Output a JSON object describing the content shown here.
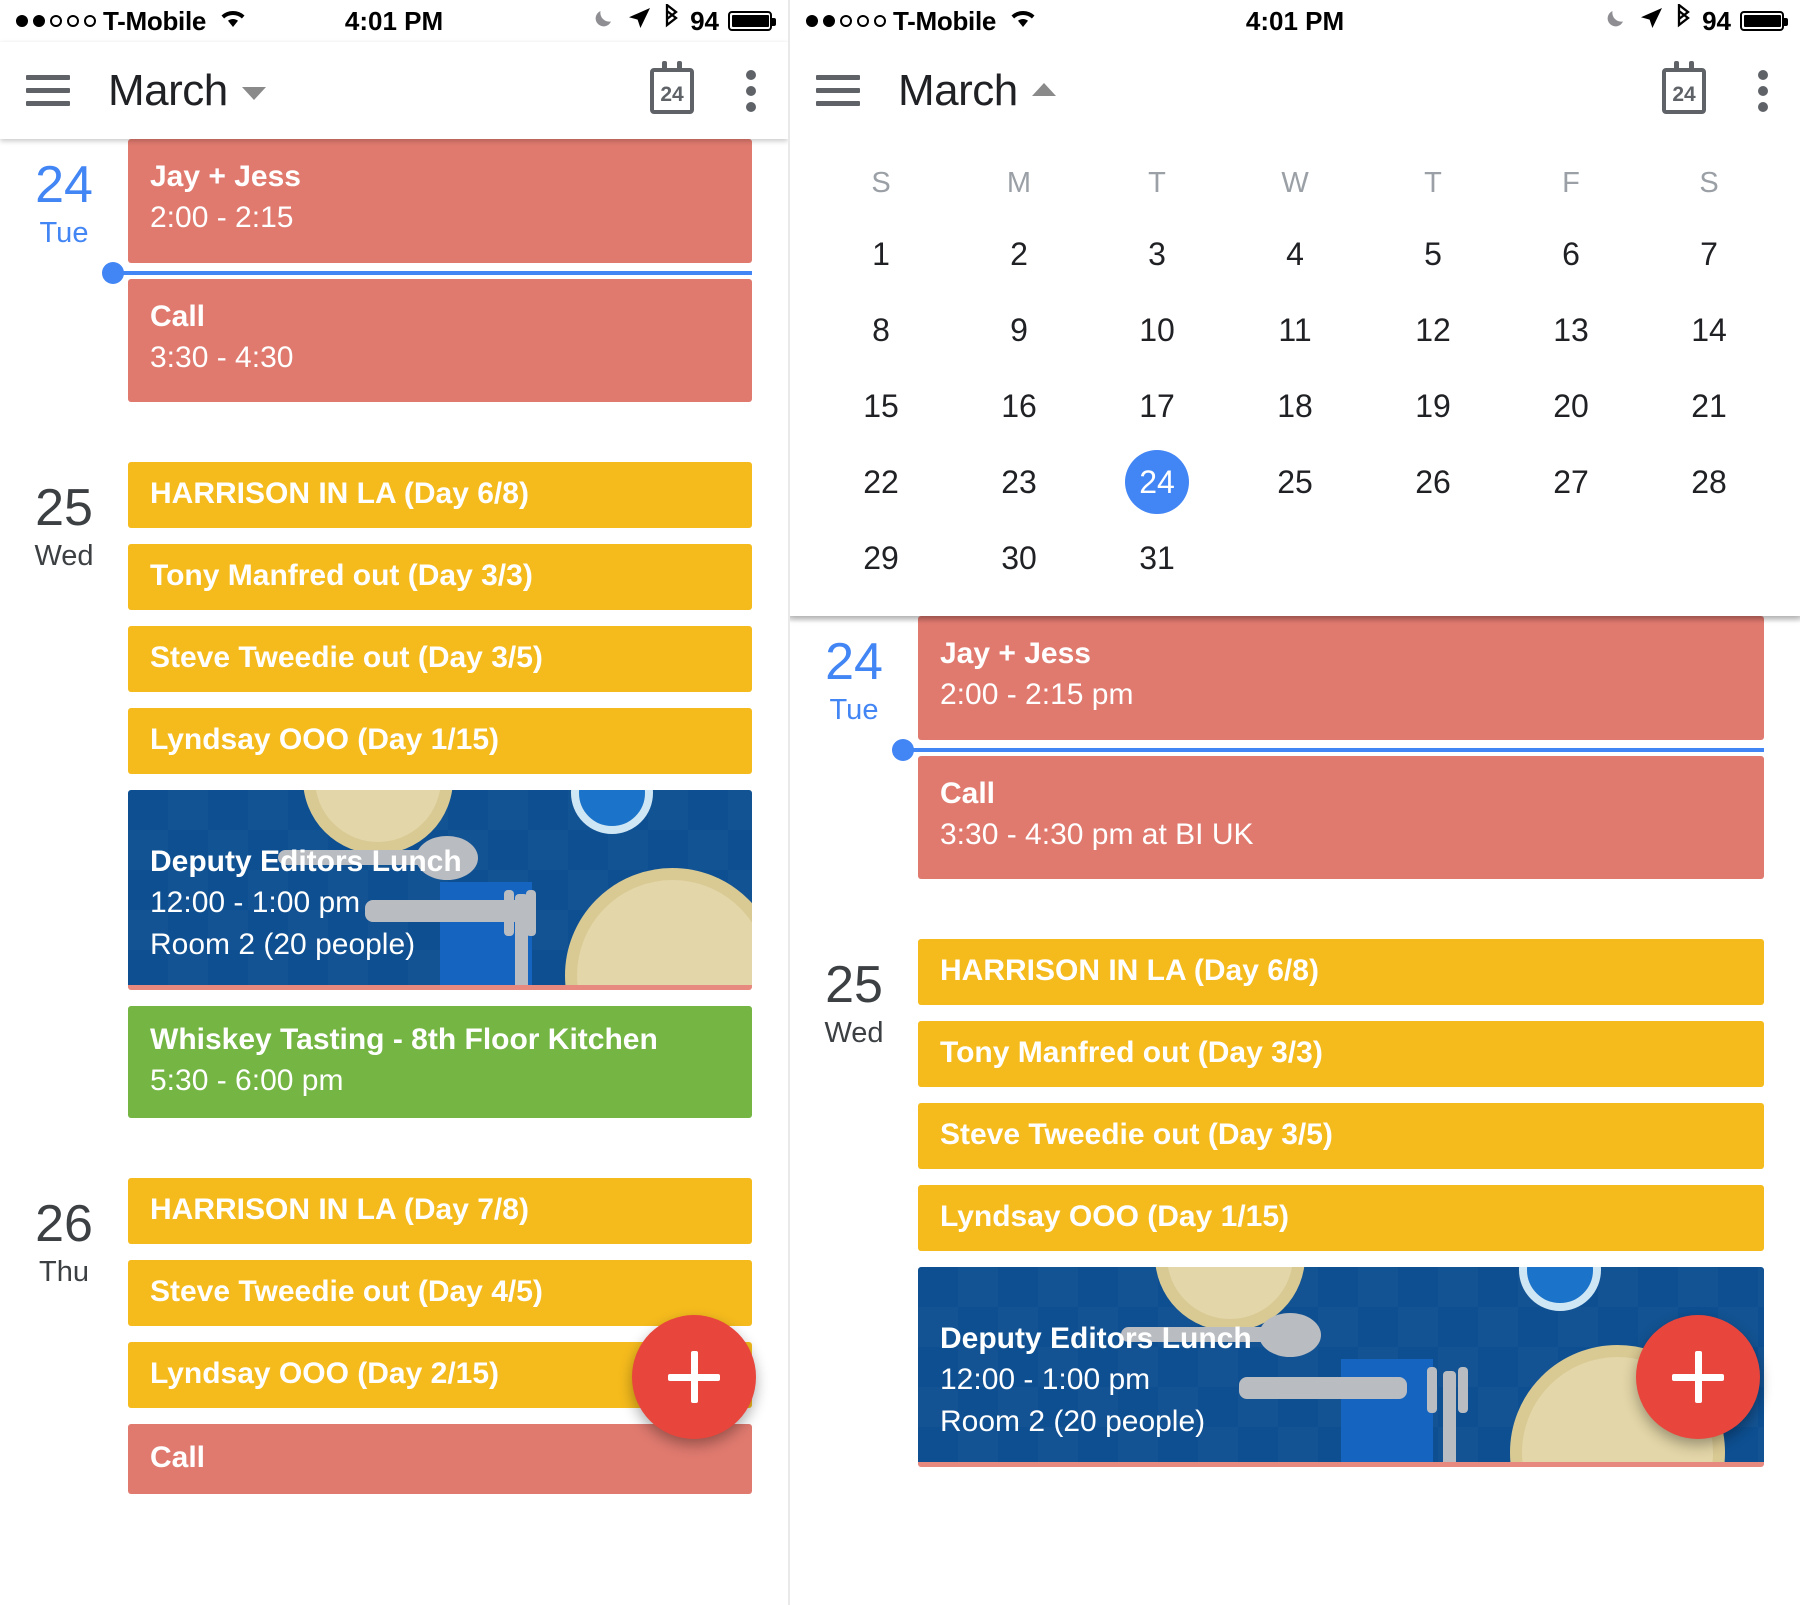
{
  "status_bar": {
    "signal_dots_filled": 2,
    "signal_dots_total": 5,
    "carrier": "T-Mobile",
    "wifi_icon": "wifi-icon",
    "time": "4:01 PM",
    "moon_icon": "do-not-disturb-moon-icon",
    "location_icon": "location-arrow-icon",
    "bluetooth_icon": "bluetooth-icon",
    "battery_percent": "94",
    "battery_icon": "battery-icon"
  },
  "colors": {
    "accent_blue": "#4285f4",
    "event_red": "#e07a6f",
    "event_yellow": "#f5bb1d",
    "event_green": "#74b544",
    "event_photo_blue": "#0d4f91",
    "fab_red": "#e8453c",
    "text_primary": "#202124",
    "text_muted": "#9aa0a6"
  },
  "left_panel": {
    "app_bar": {
      "menu_icon": "hamburger-menu-icon",
      "title": "March",
      "chevron": "chevron-down-icon",
      "today_icon_label": "24",
      "today_icon": "calendar-today-icon",
      "overflow_icon": "more-vertical-icon"
    },
    "days": [
      {
        "day_number": "24",
        "day_of_week": "Tue",
        "is_today": true,
        "events": [
          {
            "title": "Jay + Jess",
            "subtitle": "2:00 - 2:15",
            "color": "red",
            "style": "tall"
          },
          {
            "title": "Call",
            "subtitle": "3:30 - 4:30",
            "color": "red",
            "style": "tall"
          }
        ]
      },
      {
        "day_number": "25",
        "day_of_week": "Wed",
        "is_today": false,
        "events": [
          {
            "title": "HARRISON IN LA (Day 6/8)",
            "subtitle": "",
            "color": "yellow",
            "style": ""
          },
          {
            "title": "Tony Manfred out (Day 3/3)",
            "subtitle": "",
            "color": "yellow",
            "style": ""
          },
          {
            "title": "Steve Tweedie out (Day 3/5)",
            "subtitle": "",
            "color": "yellow",
            "style": ""
          },
          {
            "title": "Lyndsay OOO (Day 1/15)",
            "subtitle": "",
            "color": "yellow",
            "style": ""
          },
          {
            "title": "Deputy Editors Lunch",
            "subtitle": "12:00 - 1:00 pm",
            "subtitle2": "Room 2 (20 people)",
            "color": "photo",
            "style": "",
            "image": "place-setting-illustration"
          },
          {
            "title": "Whiskey Tasting - 8th Floor Kitchen",
            "subtitle": "5:30 - 6:00 pm",
            "color": "green",
            "style": ""
          }
        ]
      },
      {
        "day_number": "26",
        "day_of_week": "Thu",
        "is_today": false,
        "events": [
          {
            "title": "HARRISON IN LA (Day 7/8)",
            "subtitle": "",
            "color": "yellow",
            "style": ""
          },
          {
            "title": "Steve Tweedie out (Day 4/5)",
            "subtitle": "",
            "color": "yellow",
            "style": ""
          },
          {
            "title": "Lyndsay OOO (Day 2/15)",
            "subtitle": "",
            "color": "yellow",
            "style": ""
          },
          {
            "title": "Call",
            "subtitle": "",
            "color": "red",
            "style": ""
          }
        ]
      }
    ],
    "fab": {
      "icon": "plus-icon",
      "label": "+"
    }
  },
  "right_panel": {
    "app_bar": {
      "menu_icon": "hamburger-menu-icon",
      "title": "March",
      "chevron": "chevron-up-icon",
      "today_icon_label": "24",
      "today_icon": "calendar-today-icon",
      "overflow_icon": "more-vertical-icon"
    },
    "month_grid": {
      "day_headers": [
        "S",
        "M",
        "T",
        "W",
        "T",
        "F",
        "S"
      ],
      "weeks": [
        [
          "1",
          "2",
          "3",
          "4",
          "5",
          "6",
          "7"
        ],
        [
          "8",
          "9",
          "10",
          "11",
          "12",
          "13",
          "14"
        ],
        [
          "15",
          "16",
          "17",
          "18",
          "19",
          "20",
          "21"
        ],
        [
          "22",
          "23",
          "24",
          "25",
          "26",
          "27",
          "28"
        ],
        [
          "29",
          "30",
          "31",
          "",
          "",
          "",
          ""
        ]
      ],
      "selected_day": "24"
    },
    "days": [
      {
        "day_number": "24",
        "day_of_week": "Tue",
        "is_today": true,
        "events": [
          {
            "title": "Jay + Jess",
            "subtitle": "2:00 - 2:15 pm",
            "color": "red",
            "style": "tall"
          },
          {
            "title": "Call",
            "subtitle": "3:30 - 4:30 pm at BI UK",
            "color": "red",
            "style": "tall"
          }
        ]
      },
      {
        "day_number": "25",
        "day_of_week": "Wed",
        "is_today": false,
        "events": [
          {
            "title": "HARRISON IN LA (Day 6/8)",
            "subtitle": "",
            "color": "yellow",
            "style": ""
          },
          {
            "title": "Tony Manfred out (Day 3/3)",
            "subtitle": "",
            "color": "yellow",
            "style": ""
          },
          {
            "title": "Steve Tweedie out (Day 3/5)",
            "subtitle": "",
            "color": "yellow",
            "style": ""
          },
          {
            "title": "Lyndsay OOO (Day 1/15)",
            "subtitle": "",
            "color": "yellow",
            "style": ""
          },
          {
            "title": "Deputy Editors Lunch",
            "subtitle": "12:00 - 1:00 pm",
            "subtitle2": "Room 2 (20 people)",
            "color": "photo",
            "style": "",
            "image": "place-setting-illustration"
          }
        ]
      }
    ],
    "fab": {
      "icon": "plus-icon",
      "label": "+"
    }
  }
}
